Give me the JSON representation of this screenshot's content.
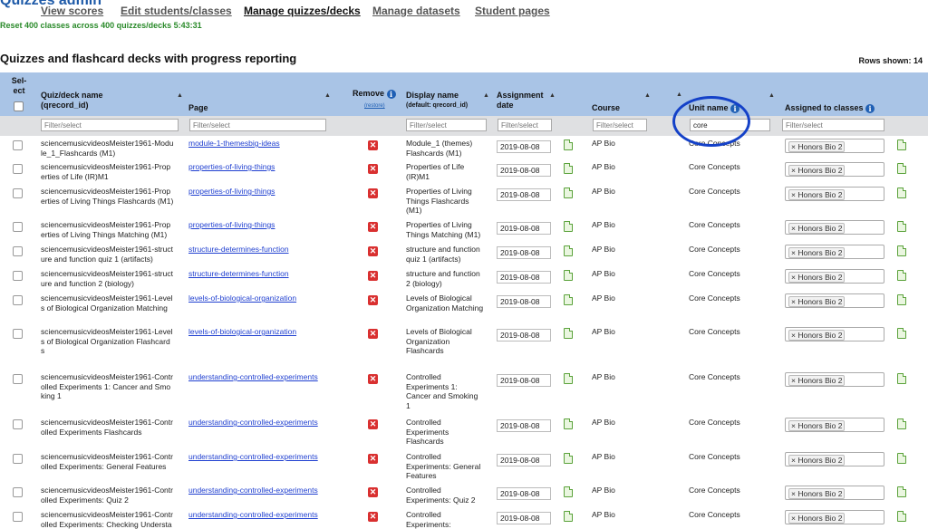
{
  "app": {
    "brand": "Quizzes admin"
  },
  "nav": {
    "view_scores": "View scores",
    "edit_students": "Edit students/classes",
    "manage_quizzes": "Manage quizzes/decks",
    "manage_datasets": "Manage datasets",
    "student_pages": "Student pages"
  },
  "reset_message": "Reset 400 classes across 400 quizzes/decks 5:43:31",
  "page_title": "Quizzes and flashcard decks with progress reporting",
  "rows_shown": "Rows shown: 14",
  "columns": {
    "select_1": "Sel-",
    "select_2": "ect",
    "quiz_name": "Quiz/deck name",
    "quiz_id": "(qrecord_id)",
    "page": "Page",
    "remove": "Remove",
    "restore": "(restore)",
    "display_name": "Display name",
    "display_default": "(default: qrecord_id)",
    "assignment_1": "Assignment",
    "assignment_2": "date",
    "course": "Course",
    "unit_name": "Unit name",
    "assigned": "Assigned to classes"
  },
  "filters": {
    "quiz_placeholder": "Filter/select",
    "page_placeholder": "Filter/select",
    "display_placeholder": "Filter/select",
    "date_placeholder": "Filter/select",
    "course_placeholder": "Filter/select",
    "unit_value": "core",
    "assigned_placeholder": "Filter/select"
  },
  "rows": [
    {
      "name": [
        "sciencemusicvideosMeister1961-Modu",
        "le_1_Flashcards (M1)"
      ],
      "page": "module-1-themesbig-ideas",
      "display": [
        "Module_1 (themes)",
        "Flashcards (M1)"
      ],
      "date": "2019-08-08",
      "course": "AP Bio",
      "unit": "Core Concepts",
      "class": "Honors Bio 2"
    },
    {
      "name": [
        "sciencemusicvideosMeister1961-Prop",
        "erties of Life (IR)M1"
      ],
      "page": "properties-of-living-things",
      "display": [
        "Properties of Life",
        "(IR)M1"
      ],
      "date": "2019-08-08",
      "course": "AP Bio",
      "unit": "Core Concepts",
      "class": "Honors Bio 2"
    },
    {
      "name": [
        "sciencemusicvideosMeister1961-Prop",
        "erties of Living Things Flashcards (M1)"
      ],
      "page": "properties-of-living-things",
      "display": [
        "Properties of Living",
        "Things Flashcards",
        "(M1)"
      ],
      "date": "2019-08-08",
      "course": "AP Bio",
      "unit": "Core Concepts",
      "class": "Honors Bio 2"
    },
    {
      "name": [
        "sciencemusicvideosMeister1961-Prop",
        "erties of Living Things Matching (M1)"
      ],
      "page": "properties-of-living-things",
      "display": [
        "Properties of Living",
        "Things Matching (M1)"
      ],
      "date": "2019-08-08",
      "course": "AP Bio",
      "unit": "Core Concepts",
      "class": "Honors Bio 2"
    },
    {
      "name": [
        "sciencemusicvideosMeister1961-struct",
        "ure and function quiz 1 (artifacts)"
      ],
      "page": "structure-determines-function",
      "display": [
        "structure and function",
        "quiz 1 (artifacts)"
      ],
      "date": "2019-08-08",
      "course": "AP Bio",
      "unit": "Core Concepts",
      "class": "Honors Bio 2"
    },
    {
      "name": [
        "sciencemusicvideosMeister1961-struct",
        "ure and function 2 (biology)"
      ],
      "page": "structure-determines-function",
      "display": [
        "structure and function",
        "2 (biology)"
      ],
      "date": "2019-08-08",
      "course": "AP Bio",
      "unit": "Core Concepts",
      "class": "Honors Bio 2"
    },
    {
      "name": [
        "sciencemusicvideosMeister1961-Level",
        "s of Biological Organization Matching"
      ],
      "page": "levels-of-biological-organization",
      "display": [
        "Levels of Biological",
        "Organization Matching"
      ],
      "date": "2019-08-08",
      "course": "AP Bio",
      "unit": "Core Concepts",
      "class": "Honors Bio 2"
    },
    {
      "name": [
        "sciencemusicvideosMeister1961-Level",
        "s of Biological Organization Flashcard",
        "s"
      ],
      "page": "levels-of-biological-organization",
      "display": [
        "Levels of Biological",
        "Organization",
        "Flashcards"
      ],
      "date": "2019-08-08",
      "course": "AP Bio",
      "unit": "Core Concepts",
      "class": "Honors Bio 2"
    },
    {
      "name": [
        "sciencemusicvideosMeister1961-Contr",
        "olled Experiments 1: Cancer and Smo",
        "king 1"
      ],
      "page": "understanding-controlled-experiments",
      "display": [
        "Controlled",
        "Experiments 1:",
        "Cancer and Smoking",
        "1"
      ],
      "date": "2019-08-08",
      "course": "AP Bio",
      "unit": "Core Concepts",
      "class": "Honors Bio 2"
    },
    {
      "name": [
        "sciencemusicvideosMeister1961-Contr",
        "olled Experiments Flashcards"
      ],
      "page": "understanding-controlled-experiments",
      "display": [
        "Controlled",
        "Experiments",
        "Flashcards"
      ],
      "date": "2019-08-08",
      "course": "AP Bio",
      "unit": "Core Concepts",
      "class": "Honors Bio 2"
    },
    {
      "name": [
        "sciencemusicvideosMeister1961-Contr",
        "olled Experiments: General Features"
      ],
      "page": "understanding-controlled-experiments",
      "display": [
        "Controlled",
        "Experiments: General",
        "Features"
      ],
      "date": "2019-08-08",
      "course": "AP Bio",
      "unit": "Core Concepts",
      "class": "Honors Bio 2"
    },
    {
      "name": [
        "sciencemusicvideosMeister1961-Contr",
        "olled Experiments: Quiz 2"
      ],
      "page": "understanding-controlled-experiments",
      "display": [
        "Controlled",
        "Experiments: Quiz 2"
      ],
      "date": "2019-08-08",
      "course": "AP Bio",
      "unit": "Core Concepts",
      "class": "Honors Bio 2"
    },
    {
      "name": [
        "sciencemusicvideosMeister1961-Contr",
        "olled Experiments: Checking Understa"
      ],
      "page": "understanding-controlled-experiments",
      "display": [
        "Controlled",
        "Experiments:"
      ],
      "date": "2019-08-08",
      "course": "AP Bio",
      "unit": "Core Concepts",
      "class": "Honors Bio 2"
    }
  ]
}
